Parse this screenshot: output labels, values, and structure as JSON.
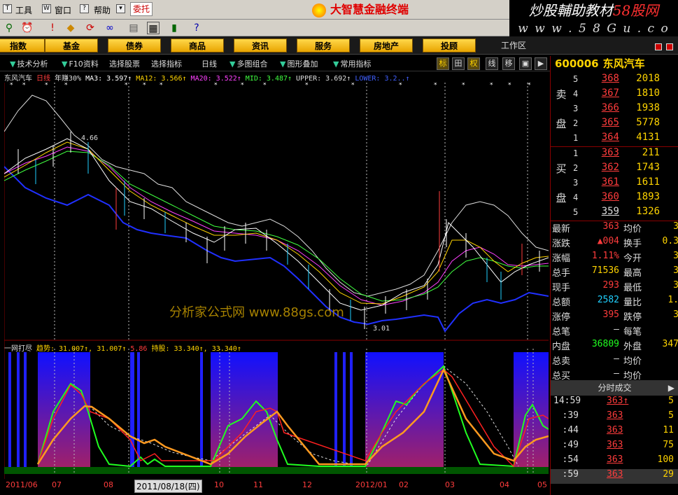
{
  "menu": {
    "items": [
      "工具",
      "窗口",
      "帮助"
    ],
    "entrust_label": "委托",
    "brand": "大智慧金融终端"
  },
  "watermark": {
    "line1_a": "炒股輔助教材",
    "line1_b": "58股网",
    "line2": "w w w . 5 8 G u . c o m"
  },
  "categories": [
    "指数",
    "基金",
    "债券",
    "商品",
    "资讯",
    "服务",
    "房地产",
    "投顾"
  ],
  "workspace_label": "工作区",
  "subbar": {
    "items": [
      "技术分析",
      "F10资料",
      "选择股票",
      "选择指标",
      "日线",
      "多图组合",
      "图形叠加",
      "常用指标"
    ],
    "tool_buttons": [
      "标",
      "田",
      "权",
      "线",
      "移",
      "▣",
      "▣",
      "▶"
    ]
  },
  "info": {
    "stock": "东风汽车",
    "period": "日线",
    "subtitle": "年赚30%",
    "ma3": "MA3: 3.597↑",
    "ma12": "MA12: 3.566↑",
    "ma20": "MA20: 3.522↑",
    "mid": "MID: 3.487↑",
    "upper": "UPPER: 3.692↑",
    "lower": "LOWER: 3.2..↑"
  },
  "chart_labels": {
    "high": "4.66",
    "low": "3.01",
    "watermark": "分析家公式网 www.88gs.com"
  },
  "indicator": {
    "name": "一网打尽",
    "trend": "趋势: 31.007↑, 31.007↑",
    "mid": "5.86",
    "hold": "持股: 33.340↑, 33.340↑"
  },
  "dates": {
    "labels": [
      "2011/06",
      "07",
      "08",
      "10",
      "11",
      "12",
      "2012/01",
      "02",
      "03",
      "04",
      "05"
    ],
    "cursor": "2011/08/18(四)"
  },
  "quote": {
    "code": "600006",
    "name": "东风汽车",
    "sell_label": [
      "卖",
      "盘"
    ],
    "buy_label": [
      "买",
      "盘"
    ],
    "sell": [
      {
        "lv": "5",
        "price": "368",
        "vol": "2018"
      },
      {
        "lv": "4",
        "price": "367",
        "vol": "1810"
      },
      {
        "lv": "3",
        "price": "366",
        "vol": "1938"
      },
      {
        "lv": "2",
        "price": "365",
        "vol": "5778"
      },
      {
        "lv": "1",
        "price": "364",
        "vol": "4131"
      }
    ],
    "buy": [
      {
        "lv": "1",
        "price": "363",
        "vol": "211"
      },
      {
        "lv": "2",
        "price": "362",
        "vol": "1743"
      },
      {
        "lv": "3",
        "price": "361",
        "vol": "1611"
      },
      {
        "lv": "4",
        "price": "360",
        "vol": "1893"
      },
      {
        "lv": "5",
        "price": "359",
        "vol": "1326"
      }
    ],
    "stats": [
      {
        "l1": "最新",
        "v1": "363",
        "c1": "#ff3c3c",
        "l2": "均价",
        "v2": "3"
      },
      {
        "l1": "涨跌",
        "v1": "▲004",
        "c1": "#ff3c3c",
        "l2": "换手",
        "v2": "0.3"
      },
      {
        "l1": "涨幅",
        "v1": "1.11%",
        "c1": "#ff3c3c",
        "l2": "今开",
        "v2": "3"
      },
      {
        "l1": "总手",
        "v1": "71536",
        "c1": "#ffd400",
        "l2": "最高",
        "v2": "3"
      },
      {
        "l1": "现手",
        "v1": "293",
        "c1": "#ff3c3c",
        "l2": "最低",
        "v2": "3"
      },
      {
        "l1": "总额",
        "v1": "2582",
        "c1": "#20d0ff",
        "l2": "量比",
        "v2": "1."
      },
      {
        "l1": "涨停",
        "v1": "395",
        "c1": "#ff3c3c",
        "l2": "跌停",
        "v2": "3"
      },
      {
        "l1": "总笔",
        "v1": "—",
        "c1": "#ddd",
        "l2": "每笔",
        "v2": ""
      },
      {
        "l1": "内盘",
        "v1": "36809",
        "c1": "#20ff20",
        "l2": "外盘",
        "v2": "347"
      },
      {
        "l1": "总卖",
        "v1": "—",
        "c1": "#ddd",
        "l2": "均价",
        "v2": ""
      },
      {
        "l1": "总买",
        "v1": "—",
        "c1": "#ddd",
        "l2": "均价",
        "v2": ""
      }
    ],
    "ticks_title": "分时成交",
    "ticks": [
      {
        "t": "14:59",
        "p": "363↑",
        "v": "5"
      },
      {
        "t": ":39",
        "p": "363",
        "v": "5"
      },
      {
        "t": ":44",
        "p": "363",
        "v": "11"
      },
      {
        "t": ":49",
        "p": "363",
        "v": "75"
      },
      {
        "t": ":54",
        "p": "363",
        "v": "100"
      },
      {
        "t": ":59",
        "p": "363",
        "v": "29"
      }
    ]
  },
  "colors": {
    "up": "#ff3c3c",
    "down": "#20d0ff",
    "gold": "#ffd400"
  }
}
